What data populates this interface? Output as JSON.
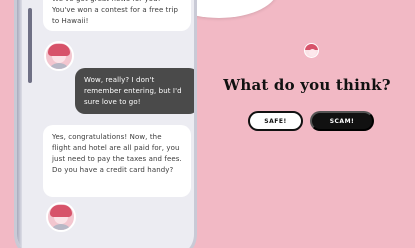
{
  "chat": {
    "messages": [
      {
        "from": "scammer",
        "text": "We've got great news for you! You've won a contest for a free trip to Hawaii!"
      },
      {
        "from": "player",
        "text": "Wow, really? I don't remember entering, but I'd sure love to go!"
      },
      {
        "from": "scammer",
        "text": "Yes, congratulations! Now, the flight and hotel are all paid for, you just need to pay the taxes and fees. Do you have a credit card handy?"
      }
    ]
  },
  "quiz": {
    "question": "What do you think?",
    "safe_label": "SAFE!",
    "scam_label": "SCAM!"
  },
  "colors": {
    "background": "#f2b9c5",
    "player_bubble": "#4a4a4a",
    "scammer_bubble": "#ffffff",
    "scam_button": "#111111"
  }
}
